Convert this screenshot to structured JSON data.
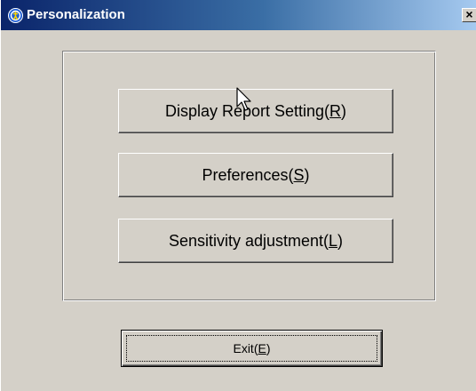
{
  "window": {
    "title": "Personalization",
    "close_label": "×"
  },
  "buttons": {
    "display_report": {
      "label": "Display Report Setting(",
      "mnemonic": "R",
      "suffix": ")"
    },
    "preferences": {
      "label": "Preferences(",
      "mnemonic": "S",
      "suffix": ")"
    },
    "sensitivity": {
      "label": "Sensitivity adjustment(",
      "mnemonic": "L",
      "suffix": ")"
    },
    "exit": {
      "label": "Exit(",
      "mnemonic": "E",
      "suffix": ")"
    }
  },
  "icons": {
    "title": "app-shield-icon",
    "cursor": "mouse-pointer-icon"
  },
  "colors": {
    "titlebar_start": "#0a246a",
    "titlebar_end": "#a6caf0",
    "face": "#d4d0c8"
  }
}
